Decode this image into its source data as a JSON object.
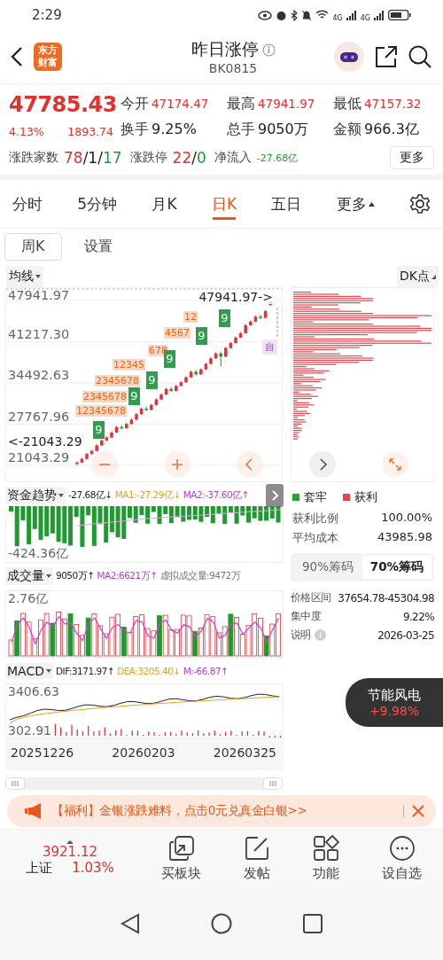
{
  "status_bar": {
    "time": "2:29",
    "network_labels": [
      "4G",
      "4G"
    ]
  },
  "header": {
    "logo": "东方财富",
    "title": "昨日涨停",
    "code": "BK0815"
  },
  "quote": {
    "price": "47785.43",
    "change_pct": "4.13%",
    "change": "1893.74",
    "stats": [
      {
        "label": "今开",
        "value": "47174.47",
        "kind": "rise"
      },
      {
        "label": "最高",
        "value": "47941.97",
        "kind": "rise"
      },
      {
        "label": "最低",
        "value": "47157.32",
        "kind": "rise"
      },
      {
        "label": "换手",
        "value": "9.25%",
        "kind": "plain"
      },
      {
        "label": "总手",
        "value": "9050万",
        "kind": "plain"
      },
      {
        "label": "金额",
        "value": "966.3亿",
        "kind": "plain"
      }
    ],
    "breadth": {
      "label": "涨跌家数",
      "parts": [
        {
          "text": "78",
          "kind": "rise"
        },
        {
          "text": "/1/",
          "kind": "plain"
        },
        {
          "text": "17",
          "kind": "fall"
        }
      ]
    },
    "limits": {
      "label": "涨跌停",
      "parts": [
        {
          "text": "22",
          "kind": "rise"
        },
        {
          "text": "/",
          "kind": "plain"
        },
        {
          "text": "0",
          "kind": "fall"
        }
      ]
    },
    "net_inflow": {
      "label": "净流入",
      "value": "-27.68亿",
      "kind": "fall"
    },
    "more_button": "更多"
  },
  "tabs": [
    {
      "label": "分时",
      "selected": false,
      "kind": "tab"
    },
    {
      "label": "5分钟",
      "selected": false,
      "kind": "tab"
    },
    {
      "label": "月K",
      "selected": false,
      "kind": "tab"
    },
    {
      "label": "日K",
      "selected": true,
      "kind": "tab"
    },
    {
      "label": "五日",
      "selected": false,
      "kind": "tab"
    },
    {
      "label": "更多",
      "selected": false,
      "kind": "menu"
    }
  ],
  "subtabs": [
    {
      "label": "周K",
      "selected": true
    },
    {
      "label": "设置",
      "selected": false
    }
  ],
  "chart": {
    "indicator_button": "均线",
    "dk_button": "DK点",
    "chart_data": {
      "type": "candlestick",
      "grid": true,
      "ohlc": [
        [
          21300,
          21700,
          21043.29,
          21500
        ],
        [
          21500,
          22300,
          21400,
          22100
        ],
        [
          22100,
          23100,
          22000,
          22900
        ],
        [
          22900,
          23600,
          22800,
          23400
        ],
        [
          23400,
          24500,
          23300,
          24300
        ],
        [
          24300,
          25300,
          24200,
          25100
        ],
        [
          25100,
          25800,
          25000,
          25600
        ],
        [
          25600,
          26600,
          25500,
          26400
        ],
        [
          26400,
          27500,
          26300,
          27300
        ],
        [
          27300,
          27600,
          26900,
          27100
        ],
        [
          27100,
          28000,
          27000,
          27800
        ],
        [
          27800,
          28700,
          27700,
          28500
        ],
        [
          28500,
          29600,
          28400,
          29400
        ],
        [
          29400,
          30500,
          29300,
          30300
        ],
        [
          30300,
          30600,
          29900,
          30100
        ],
        [
          30100,
          31100,
          30000,
          30900
        ],
        [
          30900,
          32000,
          30800,
          31800
        ],
        [
          31800,
          32800,
          31700,
          32600
        ],
        [
          32600,
          33700,
          32500,
          33500
        ],
        [
          33500,
          33800,
          33000,
          33200
        ],
        [
          33200,
          34200,
          33100,
          34000
        ],
        [
          34000,
          34800,
          33900,
          34600
        ],
        [
          34600,
          35600,
          34500,
          35400
        ],
        [
          35400,
          36500,
          35300,
          36300
        ],
        [
          36300,
          36600,
          35700,
          35900
        ],
        [
          35900,
          36900,
          35800,
          36700
        ],
        [
          36700,
          37800,
          36600,
          37600
        ],
        [
          37600,
          38700,
          37500,
          38500
        ],
        [
          38500,
          39500,
          38400,
          39300
        ],
        [
          39300,
          39600,
          37200,
          38800
        ],
        [
          38800,
          40400,
          38700,
          40200
        ],
        [
          40200,
          41200,
          40100,
          41000
        ],
        [
          41000,
          42100,
          40900,
          41900
        ],
        [
          41900,
          42800,
          41800,
          42600
        ],
        [
          42600,
          44100,
          42500,
          43900
        ],
        [
          43900,
          44700,
          43800,
          44500
        ],
        [
          44500,
          45500,
          44400,
          45300
        ],
        [
          45300,
          45600,
          44900,
          45100
        ],
        [
          45100,
          46400,
          45000,
          46200
        ],
        [
          47174.47,
          47941.97,
          47157.32,
          47785.43
        ]
      ],
      "ylim": [
        21043.29,
        47941.97
      ],
      "yticks": [
        {
          "value": 47941.97,
          "label": "47941.97"
        },
        {
          "value": 41217.3,
          "label": "41217.30"
        },
        {
          "value": 34492.63,
          "label": "34492.63"
        },
        {
          "value": 27767.96,
          "label": "27767.96"
        },
        {
          "value": 21043.29,
          "label": "21043.29"
        }
      ]
    },
    "high_marker": "47941.97->",
    "low_marker": "<-21043.29",
    "nine_badges": [
      "9",
      "9",
      "9",
      "9",
      "9",
      "9"
    ],
    "sequences": [
      "12",
      "4567",
      "678",
      "12345",
      "2345678",
      "2345678",
      "12345678"
    ],
    "auto_badge": "自"
  },
  "fund_flow": {
    "title": "资金趋势",
    "value": "-27.68亿↓",
    "ma1": "MA1:-27.29亿↓",
    "ma2": "MA2:-37.60亿↑",
    "bottom_label": "-424.36亿"
  },
  "volume": {
    "title": "成交量",
    "value": "9050万↑",
    "ma2": "MA2:6621万↑",
    "virtual": "虚拟成交量:9472万",
    "top_label": "2.76亿"
  },
  "macd": {
    "title": "MACD",
    "dif": "DIF:3171.97↑",
    "dea": "DEA:3205.40↓",
    "m": "M:-66.87↑",
    "top_label": "3406.63",
    "bottom_label": "302.91"
  },
  "dates": [
    "20251226",
    "20260203",
    "20260325"
  ],
  "chips": {
    "legend": [
      {
        "label": "套牢",
        "color": "#2fa02f"
      },
      {
        "label": "获利",
        "color": "#e04848"
      }
    ],
    "rows": [
      {
        "label": "获利比例",
        "value": "100.00%"
      },
      {
        "label": "平均成本",
        "value": "43985.98"
      }
    ],
    "toggles": [
      {
        "label": "90%筹码",
        "selected": false
      },
      {
        "label": "70%筹码",
        "selected": true
      }
    ],
    "details": [
      {
        "label": "价格区间",
        "value": "37654.78-45304.98",
        "info": false
      },
      {
        "label": "集中度",
        "value": "9.22%",
        "info": false
      },
      {
        "label": "说明",
        "value": "2026-03-25",
        "info": true
      }
    ]
  },
  "floating": {
    "name": "节能风电",
    "change": "+9.98%"
  },
  "banner": {
    "text": "【福利】金银涨跌难料，点击0元兑真金白银>>"
  },
  "bottom_nav": {
    "index": {
      "value": "3921.12",
      "name": "上证",
      "change": "1.03%"
    },
    "items": [
      {
        "label": "买板块",
        "kind": "board"
      },
      {
        "label": "发帖",
        "kind": "edit"
      },
      {
        "label": "功能",
        "kind": "apps"
      },
      {
        "label": "设自选",
        "kind": "more"
      }
    ]
  }
}
